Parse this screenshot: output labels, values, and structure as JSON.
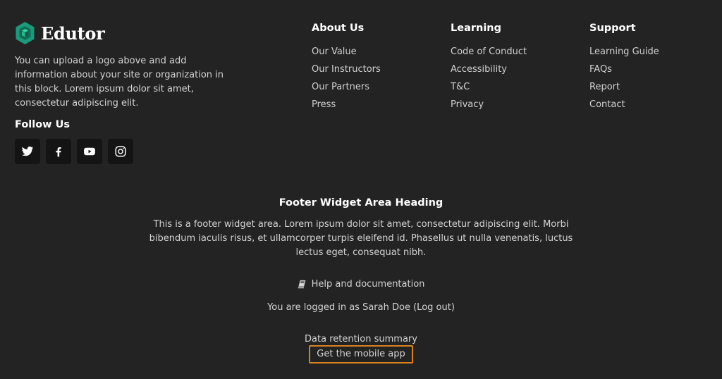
{
  "brand": {
    "name": "Edutor",
    "logo_color": "#1a9a7a",
    "description": "You can upload a logo above and add information about your site or organization in this block. Lorem ipsum dolor sit amet, consectetur adipiscing elit.",
    "follow_heading": "Follow Us",
    "social": [
      "twitter-icon",
      "facebook-icon",
      "youtube-icon",
      "instagram-icon"
    ]
  },
  "columns": {
    "about": {
      "heading": "About Us",
      "links": [
        "Our Value",
        "Our Instructors",
        "Our Partners",
        "Press"
      ]
    },
    "learning": {
      "heading": "Learning",
      "links": [
        "Code of Conduct",
        "Accessibility",
        "T&C",
        "Privacy"
      ]
    },
    "support": {
      "heading": "Support",
      "links": [
        "Learning Guide",
        "FAQs",
        "Report",
        "Contact"
      ]
    }
  },
  "widget": {
    "heading": "Footer Widget Area Heading",
    "text": "This is a footer widget area. Lorem ipsum dolor sit amet, consectetur adipiscing elit. Morbi bibendum iaculis risus, et ullamcorper turpis eleifend id. Phasellus ut nulla venenatis, luctus lectus eget, consequat nibh."
  },
  "help": {
    "icon": "book-icon",
    "label": "Help and documentation"
  },
  "login": {
    "prefix": "You are logged in as ",
    "user": "Sarah Doe",
    "logout": "(Log out)"
  },
  "retention": {
    "label": "Data retention summary"
  },
  "mobile": {
    "label": "Get the mobile app",
    "border_color": "#d9821e"
  },
  "colors": {
    "background": "#232323",
    "social_bg": "#141414",
    "heading": "#ffffff",
    "text": "#d4d4d4"
  }
}
